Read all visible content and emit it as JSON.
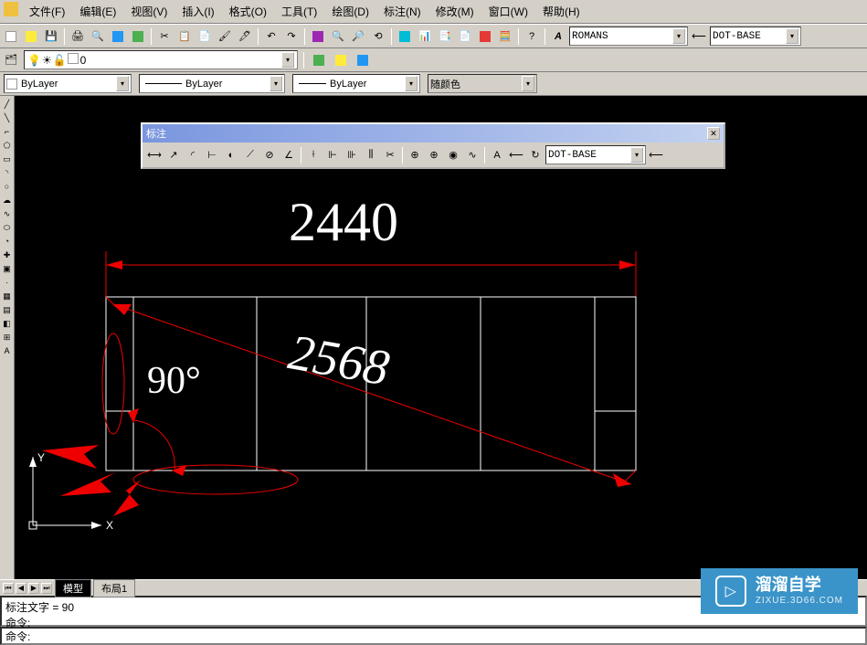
{
  "menu": {
    "items": [
      "文件(F)",
      "编辑(E)",
      "视图(V)",
      "插入(I)",
      "格式(O)",
      "工具(T)",
      "绘图(D)",
      "标注(N)",
      "修改(M)",
      "窗口(W)",
      "帮助(H)"
    ]
  },
  "toolbar1": {
    "font_style": "ROMANS",
    "dim_style": "DOT-BASE"
  },
  "layer": {
    "current": "0"
  },
  "props": {
    "color_combo": "ByLayer",
    "linetype_combo": "ByLayer",
    "lineweight_combo": "ByLayer",
    "plotstyle_combo": "随颜色"
  },
  "dim_panel": {
    "title": "标注",
    "style_combo": "DOT-BASE"
  },
  "drawing": {
    "top_dim": "2440",
    "diag_dim": "2568",
    "angle_dim": "90°",
    "axis_y": "Y",
    "axis_x": "X"
  },
  "tabs": {
    "items": [
      "模型",
      "布局1"
    ]
  },
  "command": {
    "history": "标注文字 = 90\n命令:",
    "prompt": "命令:"
  },
  "watermark": {
    "title": "溜溜自学",
    "url": "ZIXUE.3D66.COM"
  }
}
